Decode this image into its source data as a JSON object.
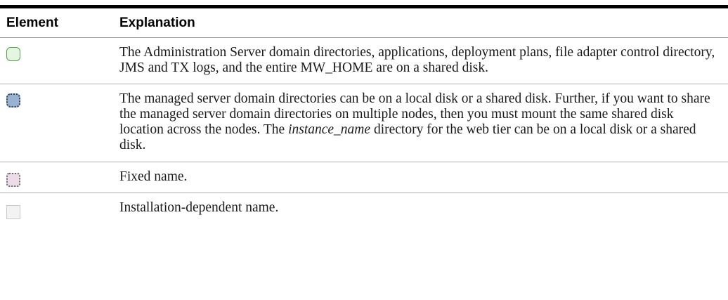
{
  "table": {
    "headers": {
      "element": "Element",
      "explanation": "Explanation"
    },
    "rows": [
      {
        "icon": "shared-disk-swatch-icon",
        "color": "#4ea349",
        "text": "The Administration Server domain directories, applications, deployment plans, file adapter control directory, JMS and TX logs, and the entire MW_HOME are on a shared disk."
      },
      {
        "icon": "local-or-shared-disk-swatch-icon",
        "color": "#9ab1cf",
        "text_before": "The managed server domain directories can be on a local disk or a shared disk. Further, if you want to share the managed server domain directories on multiple nodes, then you must mount the same shared disk location across the nodes. The ",
        "text_italic": "instance_name",
        "text_after": " directory for the web tier can be on a local disk or a shared disk."
      },
      {
        "icon": "fixed-name-swatch-icon",
        "color": "#ecdbe8",
        "text": "Fixed name."
      },
      {
        "icon": "installation-dependent-name-swatch-icon",
        "color": "#f3f3f3",
        "text": "Installation-dependent name."
      }
    ]
  }
}
